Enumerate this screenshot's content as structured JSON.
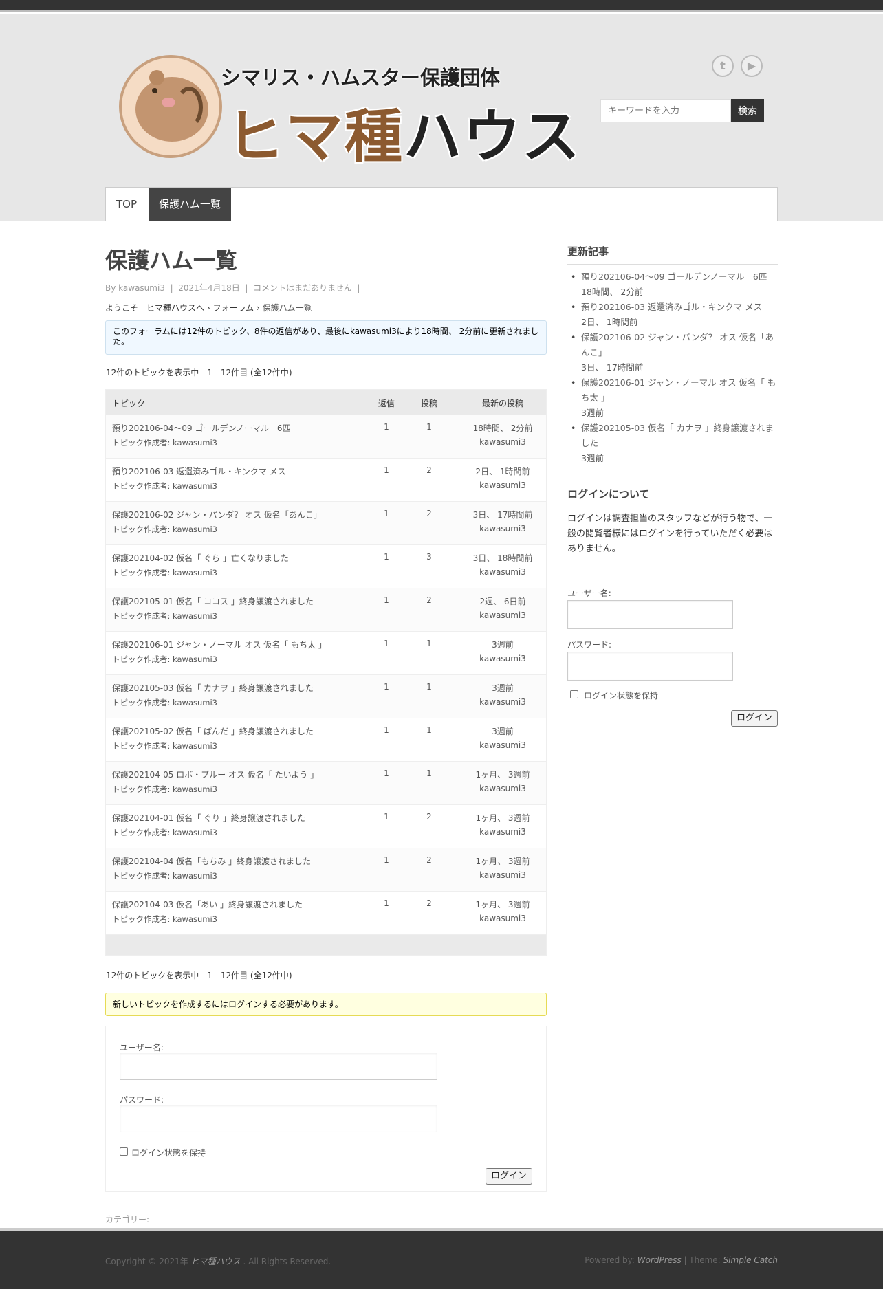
{
  "header": {
    "logo_subtitle": "シマリス・ハムスター保護団体",
    "logo_title_part1": "ヒマ種",
    "logo_title_part2": "ハウス",
    "social": [
      "twitter-icon",
      "youtube-icon"
    ],
    "search_placeholder": "キーワードを入力",
    "search_button": "検索"
  },
  "nav": {
    "items": [
      "TOP",
      "保護ハム一覧"
    ],
    "active_index": 1
  },
  "main": {
    "title": "保護ハム一覧",
    "meta": {
      "by": "By",
      "author": "kawasumi3",
      "sep": "|",
      "date": "2021年4月18日",
      "comments": "コメントはまだありません",
      "trail": "|"
    },
    "breadcrumb": {
      "home": "ようこそ　ヒマ種ハウスへ",
      "sep": "›",
      "forum": "フォーラム",
      "current": "保護ハム一覧"
    },
    "info": "このフォーラムには12件のトピック、8件の返信があり、最後にkawasumi3により18時間、 2分前に更新されました。",
    "count_text": "12件のトピックを表示中 - 1 - 12件目 (全12件中)",
    "table_headers": {
      "topic": "トピック",
      "replies": "返信",
      "posts": "投稿",
      "freshness": "最新の投稿"
    },
    "topics": [
      {
        "title": "預り202106-04～09 ゴールデンノーマル　6匹",
        "author": "トピック作成者: kawasumi3",
        "replies": "1",
        "posts": "1",
        "fresh": "18時間、 2分前",
        "fresh_by": "kawasumi3"
      },
      {
        "title": "預り202106-03 返還済みゴル・キンクマ メス",
        "author": "トピック作成者: kawasumi3",
        "replies": "1",
        "posts": "2",
        "fresh": "2日、 1時間前",
        "fresh_by": "kawasumi3"
      },
      {
        "title": "保護202106-02 ジャン・パンダ？ オス 仮名「あんこ」",
        "author": "トピック作成者: kawasumi3",
        "replies": "1",
        "posts": "2",
        "fresh": "3日、 17時間前",
        "fresh_by": "kawasumi3"
      },
      {
        "title": "保護202104-02 仮名「 ぐら 」亡くなりました",
        "author": "トピック作成者: kawasumi3",
        "replies": "1",
        "posts": "3",
        "fresh": "3日、 18時間前",
        "fresh_by": "kawasumi3"
      },
      {
        "title": "保護202105-01 仮名「 ココス 」終身譲渡されました",
        "author": "トピック作成者: kawasumi3",
        "replies": "1",
        "posts": "2",
        "fresh": "2週、 6日前",
        "fresh_by": "kawasumi3"
      },
      {
        "title": "保護202106-01 ジャン・ノーマル オス 仮名「 もち太 」",
        "author": "トピック作成者: kawasumi3",
        "replies": "1",
        "posts": "1",
        "fresh": "3週前",
        "fresh_by": "kawasumi3"
      },
      {
        "title": "保護202105-03 仮名「 カナヲ 」終身譲渡されました",
        "author": "トピック作成者: kawasumi3",
        "replies": "1",
        "posts": "1",
        "fresh": "3週前",
        "fresh_by": "kawasumi3"
      },
      {
        "title": "保護202105-02 仮名「 ぱんだ 」終身譲渡されました",
        "author": "トピック作成者: kawasumi3",
        "replies": "1",
        "posts": "1",
        "fresh": "3週前",
        "fresh_by": "kawasumi3"
      },
      {
        "title": "保護202104-05 ロボ・ブルー オス 仮名「 たいよう 」",
        "author": "トピック作成者: kawasumi3",
        "replies": "1",
        "posts": "1",
        "fresh": "1ヶ月、 3週前",
        "fresh_by": "kawasumi3"
      },
      {
        "title": "保護202104-01 仮名「 ぐり 」終身譲渡されました",
        "author": "トピック作成者: kawasumi3",
        "replies": "1",
        "posts": "2",
        "fresh": "1ヶ月、 3週前",
        "fresh_by": "kawasumi3"
      },
      {
        "title": "保護202104-04 仮名「もちみ 」終身譲渡されました",
        "author": "トピック作成者: kawasumi3",
        "replies": "1",
        "posts": "2",
        "fresh": "1ヶ月、 3週前",
        "fresh_by": "kawasumi3"
      },
      {
        "title": "保護202104-03 仮名「あい 」終身譲渡されました",
        "author": "トピック作成者: kawasumi3",
        "replies": "1",
        "posts": "2",
        "fresh": "1ヶ月、 3週前",
        "fresh_by": "kawasumi3"
      }
    ],
    "notice": "新しいトピックを作成するにはログインする必要があります。",
    "login": {
      "username_label": "ユーザー名:",
      "password_label": "パスワード:",
      "remember": "ログイン状態を保持",
      "button": "ログイン"
    },
    "category": "カテゴリー:"
  },
  "sidebar": {
    "recent_title": "更新記事",
    "recent": [
      {
        "title": "預り202106-04～09 ゴールデンノーマル　6匹",
        "date": "18時間、 2分前"
      },
      {
        "title": "預り202106-03 返還済みゴル・キンクマ メス",
        "date": "2日、 1時間前"
      },
      {
        "title": "保護202106-02 ジャン・パンダ？ オス 仮名「あんこ」",
        "date": "3日、 17時間前"
      },
      {
        "title": "保護202106-01 ジャン・ノーマル オス 仮名「 もち太 」",
        "date": "3週前"
      },
      {
        "title": "保護202105-03 仮名「 カナヲ 」終身譲渡されました",
        "date": "3週前"
      }
    ],
    "about_title": "ログインについて",
    "about_text": "ログインは調査担当のスタッフなどが行う物で、一般の閲覧者様にはログインを行っていただく必要はありません。",
    "login": {
      "username_label": "ユーザー名:",
      "password_label": "パスワード:",
      "remember": "ログイン状態を保持",
      "button": "ログイン"
    }
  },
  "footer": {
    "copyright_prefix": "Copyright © 2021年",
    "site_name": "ヒマ種ハウス",
    "rights": ". All Rights Reserved.",
    "powered_prefix": "Powered by:",
    "wordpress": "WordPress",
    "theme_sep": "| Theme:",
    "theme": "Simple Catch"
  }
}
